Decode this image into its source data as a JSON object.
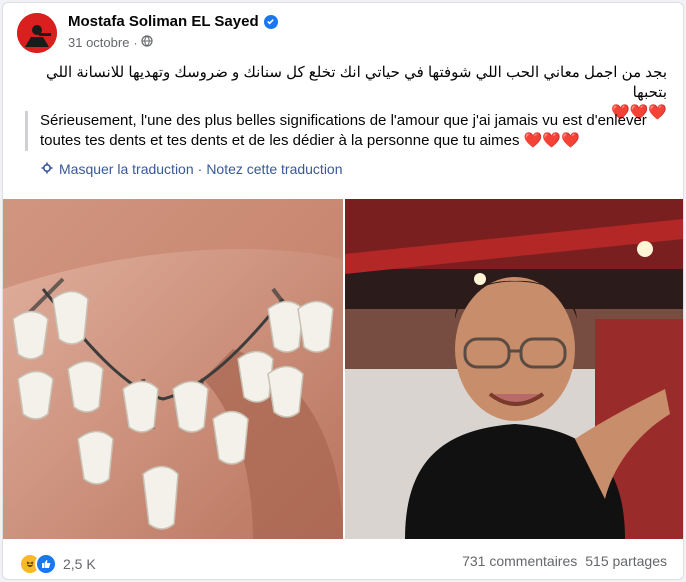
{
  "post": {
    "author": "Mostafa Soliman EL Sayed",
    "date": "31 octobre",
    "date_separator": "·",
    "arabic_text": "بجد من اجمل معاني الحب اللي شوفتها في حياتي انك تخلع كل سنانك و ضروسك وتهديها للانسانة اللي بتحبها",
    "arabic_hearts": "❤️❤️❤️",
    "translation_text": "Sérieusement, l'une des plus belles significations de l'amour que j'ai jamais vu est d'enlever toutes tes dents et tes dents et de les dédier à la personne que tu aimes",
    "translation_hearts": "❤️❤️❤️",
    "hide_translation": "Masquer la traduction",
    "link_separator": "·",
    "rate_translation": "Notez cette traduction"
  },
  "footer": {
    "reaction_count": "2,5 K",
    "comments": "731 commentaires",
    "shares": "515 partages"
  },
  "colors": {
    "link": "#385898",
    "verified": "#1877f2",
    "meta": "#65676b"
  },
  "icons": [
    "verified-icon",
    "globe-icon",
    "gear-icon",
    "haha-reaction-icon",
    "like-reaction-icon"
  ]
}
